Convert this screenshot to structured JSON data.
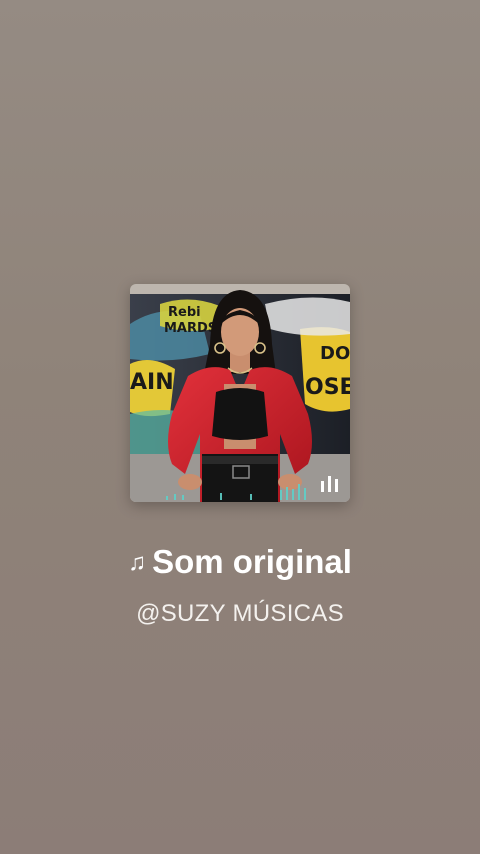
{
  "sound": {
    "note_icon": "♫",
    "title": "Som original",
    "author": "@SUZY MÚSICAS"
  },
  "artwork": {
    "icon": "sound-bars-icon",
    "graffiti_text": [
      "Rebi",
      "MARDS",
      "DO",
      "AIN",
      "OSEI"
    ]
  }
}
